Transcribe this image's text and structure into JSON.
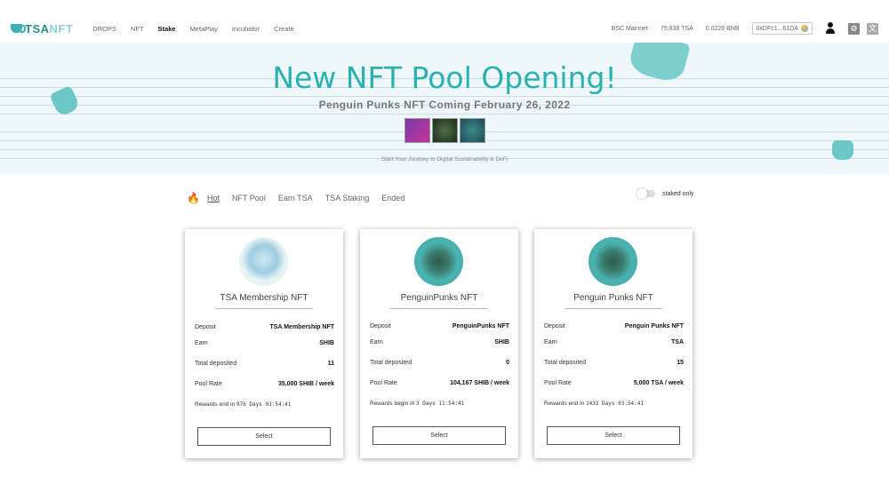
{
  "nav": {
    "logo_tsa": "TSA",
    "logo_nft": "NFT",
    "links": [
      "DROPS",
      "NFT",
      "Stake",
      "MetaPlay",
      "Incubator",
      "Create"
    ],
    "active_link": "Stake",
    "network": "BSC Mainnet",
    "tsa_balance": "75,638 TSA",
    "bnb_balance": "0.0229 BNB",
    "address": "0xDFc1...61DA"
  },
  "banner": {
    "title": "New NFT Pool Opening!",
    "subtitle": "Penguin Punks NFT Coming February 26, 2022",
    "footer": "Start Your Journey to Digital Sustainability & DeFi"
  },
  "tabs": {
    "items": [
      "Hot",
      "NFT Pool",
      "Earn TSA",
      "TSA Staking",
      "Ended"
    ],
    "active": "Hot",
    "staked_only_label": "staked only"
  },
  "cards": [
    {
      "title": "TSA Membership NFT",
      "deposit_label": "Deposit",
      "deposit": "TSA Membership NFT",
      "earn_label": "Earn",
      "earn": "SHIB",
      "total_label": "Total deposited",
      "total": "11",
      "rate_label": "Pool Rate",
      "rate": "35,000 SHIB / week",
      "reward_label": "Rewards end in",
      "reward_time": "976 Days 03:54:41",
      "button": "Select"
    },
    {
      "title": "PenguinPunks NFT",
      "deposit_label": "Deposit",
      "deposit": "PenguinPunks NFT",
      "earn_label": "Earn",
      "earn": "SHIB",
      "total_label": "Total deposited",
      "total": "0",
      "rate_label": "Pool Rate",
      "rate": "104,167 SHIB / week",
      "reward_label": "Rewards begin in",
      "reward_time": "3 Days 11:54:41",
      "button": "Select"
    },
    {
      "title": "Penguin Punks NFT",
      "deposit_label": "Deposit",
      "deposit": "Penguin Punks NFT",
      "earn_label": "Earn",
      "earn": "TSA",
      "total_label": "Total deposited",
      "total": "15",
      "rate_label": "Pool Rate",
      "rate": "5,000 TSA / week",
      "reward_label": "Rewards end in",
      "reward_time": "1432 Days 03:54:41",
      "button": "Select"
    }
  ],
  "colors": {
    "brand": "#2bb2b0",
    "fire": "#d94a2a"
  }
}
